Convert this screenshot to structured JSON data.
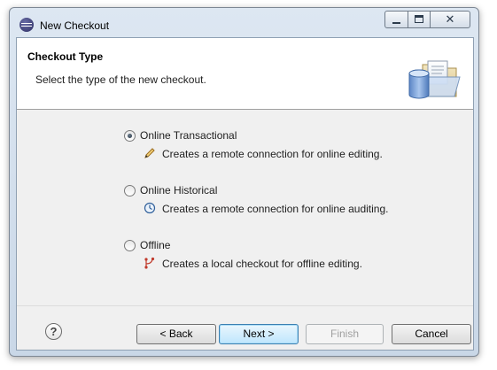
{
  "window": {
    "title": "New Checkout",
    "controls": {
      "minimize_icon": "minimize-icon",
      "maximize_icon": "maximize-icon",
      "close_icon": "close-icon"
    }
  },
  "header": {
    "title": "Checkout Type",
    "description": "Select the type of the new checkout.",
    "banner_icon": "checkout-wizard-icon"
  },
  "options": [
    {
      "label": "Online Transactional",
      "description": "Creates a remote connection for online editing.",
      "icon": "pencil-icon",
      "selected": true
    },
    {
      "label": "Online Historical",
      "description": "Creates a remote connection for online auditing.",
      "icon": "clock-icon",
      "selected": false
    },
    {
      "label": "Offline",
      "description": "Creates a local checkout for offline editing.",
      "icon": "branch-icon",
      "selected": false
    }
  ],
  "footer": {
    "help_icon": "help-icon",
    "help_glyph": "?",
    "back_label": "< Back",
    "next_label": "Next >",
    "finish_label": "Finish",
    "cancel_label": "Cancel"
  }
}
